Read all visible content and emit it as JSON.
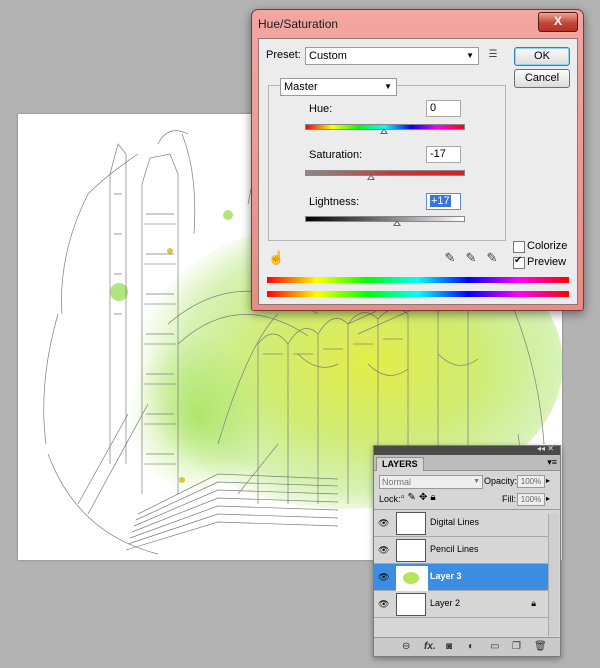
{
  "dialog": {
    "title": "Hue/Saturation",
    "close_glyph": "X",
    "preset_label": "Preset:",
    "preset_value": "Custom",
    "ok_label": "OK",
    "cancel_label": "Cancel",
    "channel_value": "Master",
    "hue_label": "Hue:",
    "hue_value": "0",
    "hue_level": 0.5,
    "saturation_label": "Saturation:",
    "saturation_value": "-17",
    "saturation_level": 0.415,
    "lightness_label": "Lightness:",
    "lightness_value": "+17",
    "lightness_level": 0.585,
    "colorize_label": "Colorize",
    "colorize_checked": false,
    "preview_label": "Preview",
    "preview_checked": true
  },
  "layers_panel": {
    "tab_label": "LAYERS",
    "blend_mode": "Normal",
    "opacity_label": "Opacity:",
    "opacity_value": "100%",
    "lock_label": "Lock:",
    "fill_label": "Fill:",
    "fill_value": "100%",
    "layers": [
      {
        "name": "Digital Lines",
        "visible": true,
        "selected": false
      },
      {
        "name": "Pencil Lines",
        "visible": true,
        "selected": false
      },
      {
        "name": "Layer 3",
        "visible": true,
        "selected": true
      },
      {
        "name": "Layer 2",
        "visible": true,
        "selected": false,
        "locked": true
      }
    ],
    "bottom_icons": [
      "link-icon",
      "fx-icon",
      "mask-icon",
      "adjustment-icon",
      "folder-icon",
      "new-layer-icon",
      "trash-icon"
    ]
  },
  "colors": {
    "selected_row": "#3d8de3",
    "dialog_frame": "#e88d86",
    "wash_green": "#a6e25a",
    "wash_yellow": "#e6ee3a"
  }
}
